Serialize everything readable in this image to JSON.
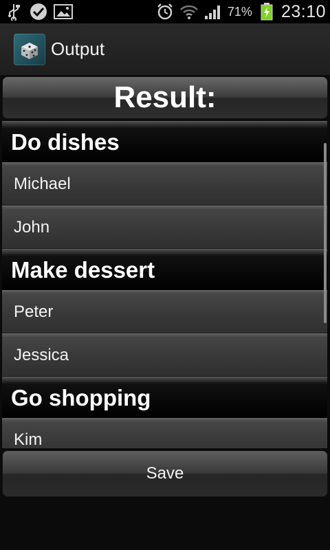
{
  "status_bar": {
    "icons_left": [
      "usb-icon",
      "check-icon",
      "gallery-icon"
    ],
    "icons_right": [
      "alarm-icon",
      "wifi-icon",
      "signal-icon",
      "battery-charging-icon"
    ],
    "battery_percent": "71%",
    "time": "23:10"
  },
  "action_bar": {
    "title": "Output",
    "icon": "dice-icon"
  },
  "result_header": "Result:",
  "groups": [
    {
      "title": "Do dishes",
      "members": [
        "Michael",
        "John"
      ]
    },
    {
      "title": "Make dessert",
      "members": [
        "Peter",
        "Jessica"
      ]
    },
    {
      "title": "Go shopping",
      "members": [
        "Kim"
      ]
    }
  ],
  "save_label": "Save",
  "colors": {
    "background": "#0b0b0b",
    "battery_charge": "#7ed321"
  }
}
